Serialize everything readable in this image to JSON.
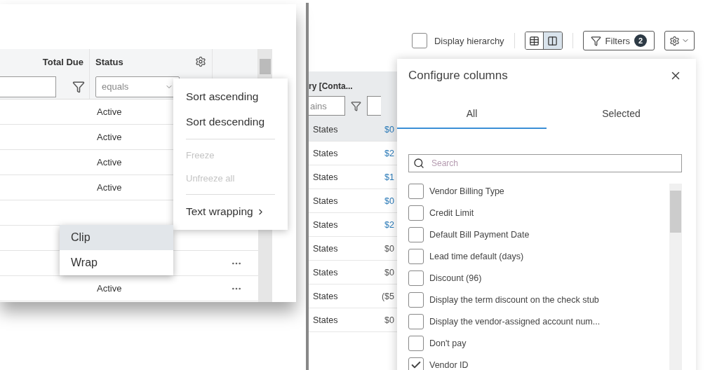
{
  "left_grid": {
    "columns": [
      {
        "label": "Total Due"
      },
      {
        "label": "Status"
      }
    ],
    "status_filter": {
      "value": "equals"
    },
    "rows": [
      {
        "status": "Active"
      },
      {
        "status": "Active"
      },
      {
        "status": "Active"
      },
      {
        "status": "Active"
      },
      {},
      {},
      {
        "more": true
      },
      {
        "status": "Active",
        "more": true
      }
    ],
    "column_menu": {
      "items": [
        {
          "kind": "item",
          "label": "Sort ascending",
          "disabled": false
        },
        {
          "kind": "item",
          "label": "Sort descending",
          "disabled": false
        },
        {
          "kind": "divider"
        },
        {
          "kind": "item",
          "label": "Freeze",
          "disabled": true
        },
        {
          "kind": "item",
          "label": "Unfreeze all",
          "disabled": true
        },
        {
          "kind": "divider"
        },
        {
          "kind": "submenu",
          "label": "Text wrapping",
          "disabled": false
        }
      ]
    },
    "wrap_submenu": {
      "items": [
        {
          "label": "Clip",
          "selected": true
        },
        {
          "label": "Wrap",
          "selected": false
        }
      ]
    }
  },
  "right_view": {
    "toolbar": {
      "display_hierarchy": {
        "label": "Display hierarchy",
        "checked": false
      },
      "views": [
        {
          "kind": "list",
          "selected": false
        },
        {
          "kind": "split",
          "selected": true
        }
      ],
      "filters": {
        "label": "Filters",
        "count": "2"
      }
    },
    "table": {
      "header": "ry [Conta...",
      "filter_value": "ains",
      "rows": [
        {
          "country": "States",
          "amount": "$0",
          "linked": true
        },
        {
          "country": "States",
          "amount": "$2",
          "linked": true
        },
        {
          "country": "States",
          "amount": "$1",
          "linked": true
        },
        {
          "country": "States",
          "amount": "$0",
          "linked": true
        },
        {
          "country": "States",
          "amount": "$2",
          "linked": true
        },
        {
          "country": "States",
          "amount": "$0",
          "linked": false
        },
        {
          "country": "States",
          "amount": "$0",
          "linked": false
        },
        {
          "country": "States",
          "amount": "($5",
          "linked": false
        },
        {
          "country": "States",
          "amount": "$0",
          "linked": false
        }
      ]
    },
    "configure_columns": {
      "title": "Configure columns",
      "tabs": [
        {
          "label": "All",
          "selected": true
        },
        {
          "label": "Selected",
          "selected": false
        }
      ],
      "search": {
        "placeholder": "Search"
      },
      "columns": [
        {
          "label": "Vendor Billing Type",
          "checked": false
        },
        {
          "label": "Credit Limit",
          "checked": false
        },
        {
          "label": "Default Bill Payment Date",
          "checked": false
        },
        {
          "label": "Lead time default (days)",
          "checked": false
        },
        {
          "label": "Discount (96)",
          "checked": false
        },
        {
          "label": "Display the term discount on the check stub",
          "checked": false
        },
        {
          "label": "Display the vendor-assigned account num...",
          "checked": false
        },
        {
          "label": "Don't pay",
          "checked": false
        },
        {
          "label": "Vendor ID",
          "checked": true
        }
      ]
    }
  }
}
